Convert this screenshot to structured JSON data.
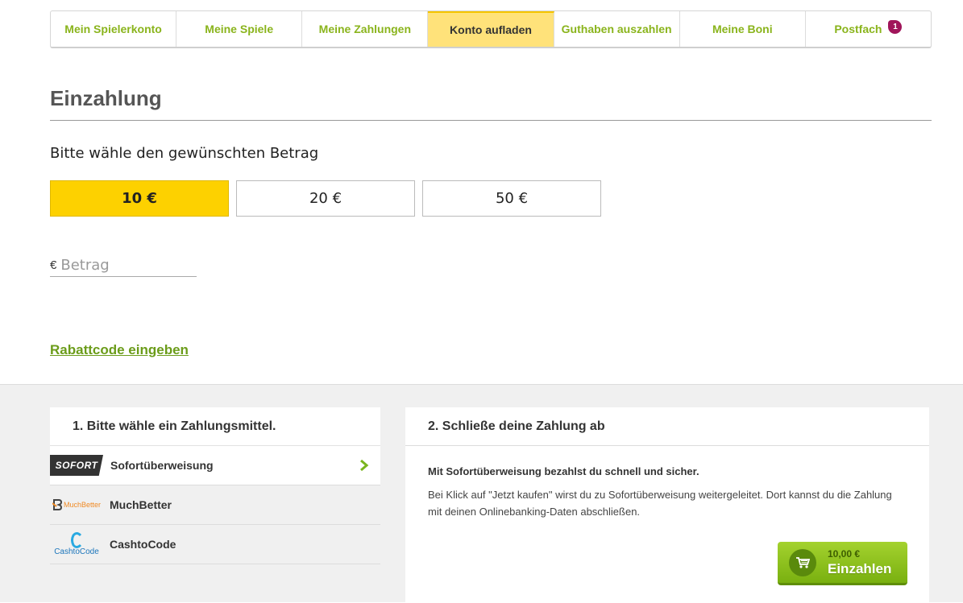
{
  "nav": {
    "tabs": [
      {
        "label": "Mein Spielerkonto"
      },
      {
        "label": "Meine Spiele"
      },
      {
        "label": "Meine Zahlungen"
      },
      {
        "label": "Konto aufladen"
      },
      {
        "label": "Guthaben auszahlen"
      },
      {
        "label": "Meine Boni"
      },
      {
        "label": "Postfach",
        "badge": "1"
      }
    ],
    "active_tab": "Konto aufladen"
  },
  "deposit": {
    "title": "Einzahlung",
    "prompt": "Bitte wähle den gewünschten Betrag",
    "amounts": [
      "10 €",
      "20 €",
      "50 €"
    ],
    "selected_amount": "10 €",
    "amount_currency": "€",
    "amount_placeholder": "Betrag",
    "amount_value": "",
    "coupon_link": "Rabattcode eingeben"
  },
  "payment_methods": {
    "heading": "1. Bitte wähle ein Zahlungsmittel.",
    "items": [
      {
        "name": "Sofortüberweisung",
        "logo_text": "SOFORT",
        "selected": true
      },
      {
        "name": "MuchBetter",
        "logo_text": "MuchBetter"
      },
      {
        "name": "CashtoCode",
        "logo_text": "CashtoCode"
      }
    ]
  },
  "checkout": {
    "heading": "2. Schließe deine Zahlung ab",
    "info_bold": "Mit Sofortüberweisung bezahlst du schnell und sicher.",
    "info_text": "Bei Klick auf \"Jetzt kaufen\" wirst du zu Sofortüberweisung weitergeleitet. Dort kannst du die Zahlung mit deinen Onlinebanking-Daten abschließen.",
    "button_amount": "10,00 €",
    "button_label": "Einzahlen"
  },
  "colors": {
    "accent_green": "#8ab41c",
    "active_tab": "#ffe27a",
    "selected_amount": "#fdd100",
    "badge": "#a0155a",
    "button_green": "#79b010"
  }
}
